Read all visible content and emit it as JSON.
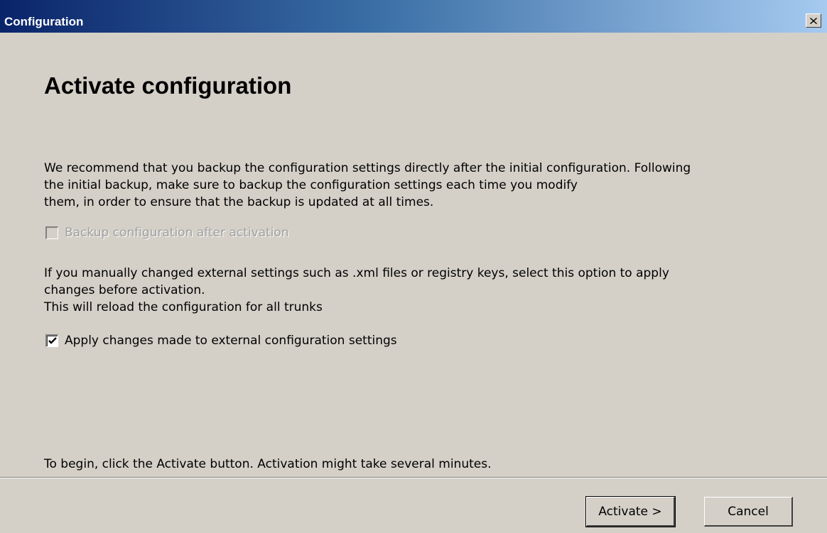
{
  "window": {
    "title": "Configuration"
  },
  "page": {
    "heading": "Activate configuration",
    "backup_text_lines": [
      "We recommend that you backup the configuration settings directly after the initial configuration. Following",
      "the initial backup, make sure to backup the configuration settings each time you modify",
      "them, in order to ensure that the backup is updated at all times."
    ],
    "backup_checkbox": {
      "label": "Backup configuration after activation",
      "checked": false,
      "enabled": false
    },
    "external_text_lines": [
      "If you manually changed external settings such as .xml files or registry keys, select this option to apply",
      "changes before activation.",
      "This will reload the configuration for all trunks"
    ],
    "external_checkbox": {
      "label": "Apply changes made to external configuration settings",
      "checked": true,
      "enabled": true
    },
    "begin_text": "To begin, click the Activate button. Activation might take several minutes."
  },
  "buttons": {
    "activate_label": "Activate >",
    "cancel_label": "Cancel"
  },
  "icons": {
    "close": "close-icon",
    "checkmark": "checkmark-icon"
  },
  "colors": {
    "titlebar_start": "#0a246a",
    "titlebar_end": "#a6caf0",
    "dialog_bg": "#d4d0c8"
  }
}
